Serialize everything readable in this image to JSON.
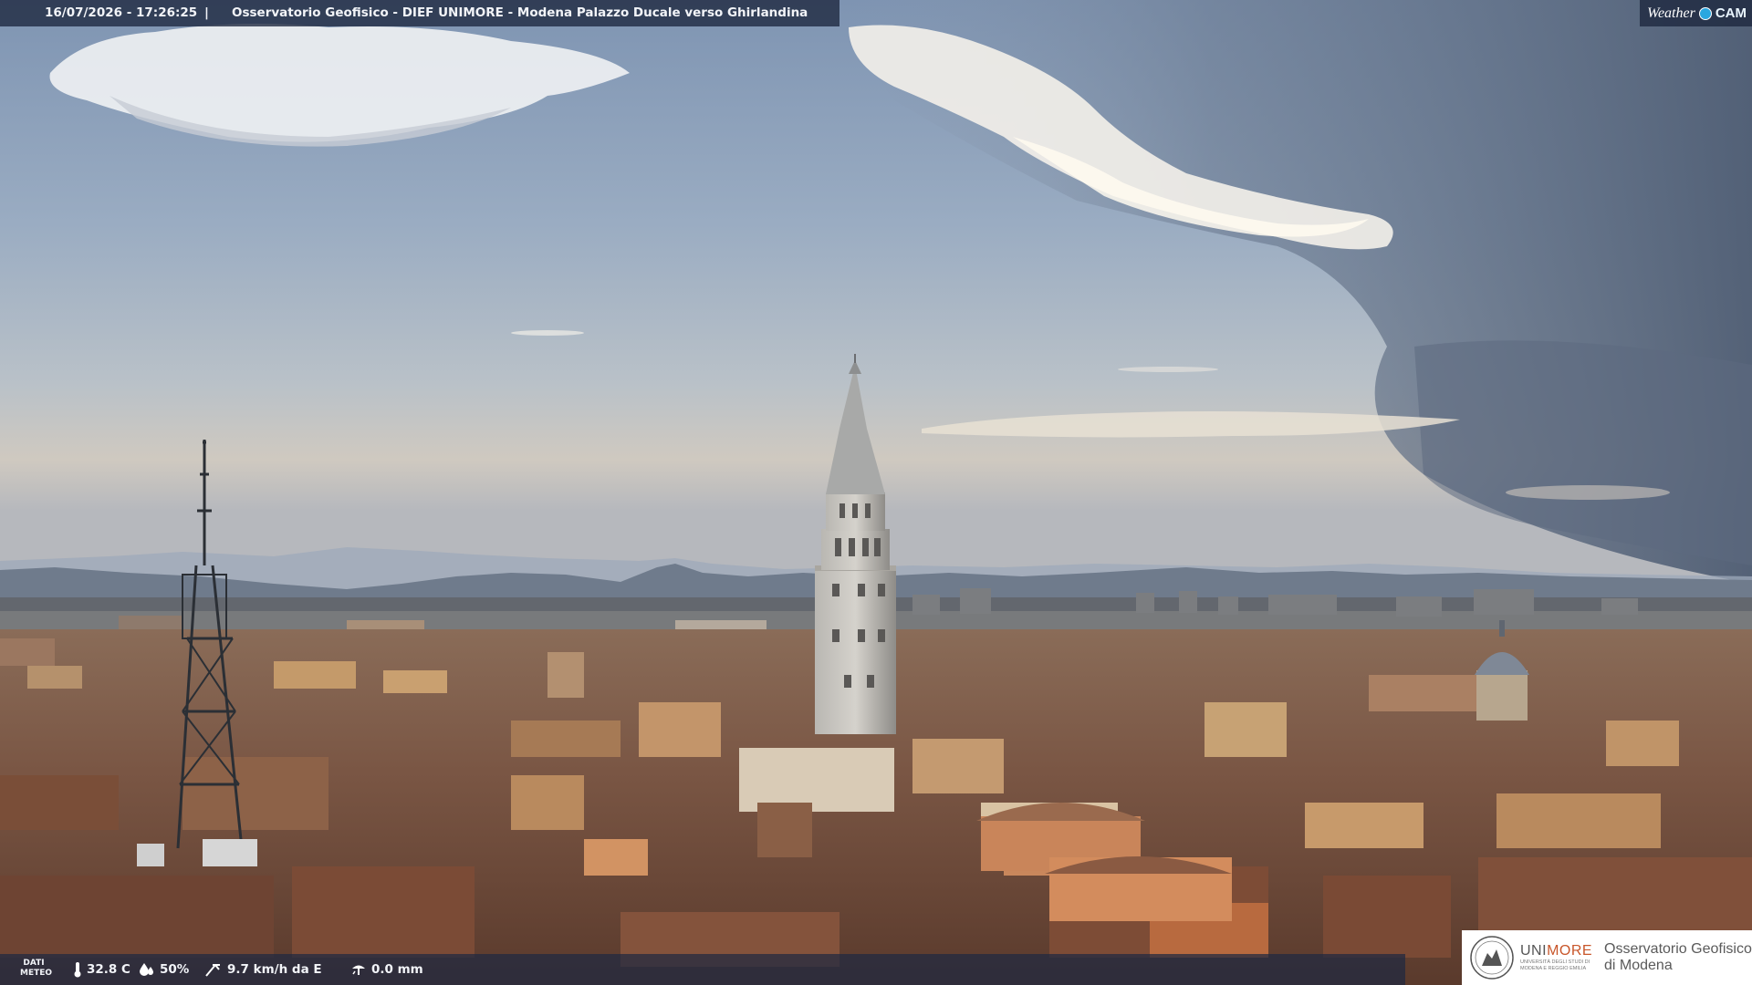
{
  "overlay_top": {
    "timestamp": "16/07/2026 - 17:26:25",
    "separator": "|",
    "title": "Osservatorio Geofisico - DIEF UNIMORE - Modena Palazzo Ducale verso Ghirlandina"
  },
  "brand_logo": {
    "weather": "Weather",
    "cam": "CAM",
    "accent_color": "#2aa7e0"
  },
  "overlay_bottom": {
    "dati_meteo_line1": "DATI",
    "dati_meteo_line2": "METEO",
    "temperature": "32.8 C",
    "humidity": "50%",
    "wind": "9.7 km/h da E",
    "rain": "0.0 mm",
    "icons": [
      "thermometer-icon",
      "humidity-drop-icon",
      "wind-icon",
      "rain-gauge-icon"
    ]
  },
  "unimore_logo": {
    "uni": "UNI",
    "more": "MORE",
    "subline1": "UNIVERSITÀ DEGLI STUDI DI",
    "subline2": "MODENA E REGGIO EMILIA",
    "observatory_line1": "Osservatorio Geofisico",
    "observatory_line2": "di Modena",
    "accent_color": "#c8562a"
  },
  "scene": {
    "description_tags": [
      "sky",
      "clouds",
      "mountains",
      "rooftops",
      "bell-tower",
      "antenna-mast",
      "dome"
    ]
  }
}
